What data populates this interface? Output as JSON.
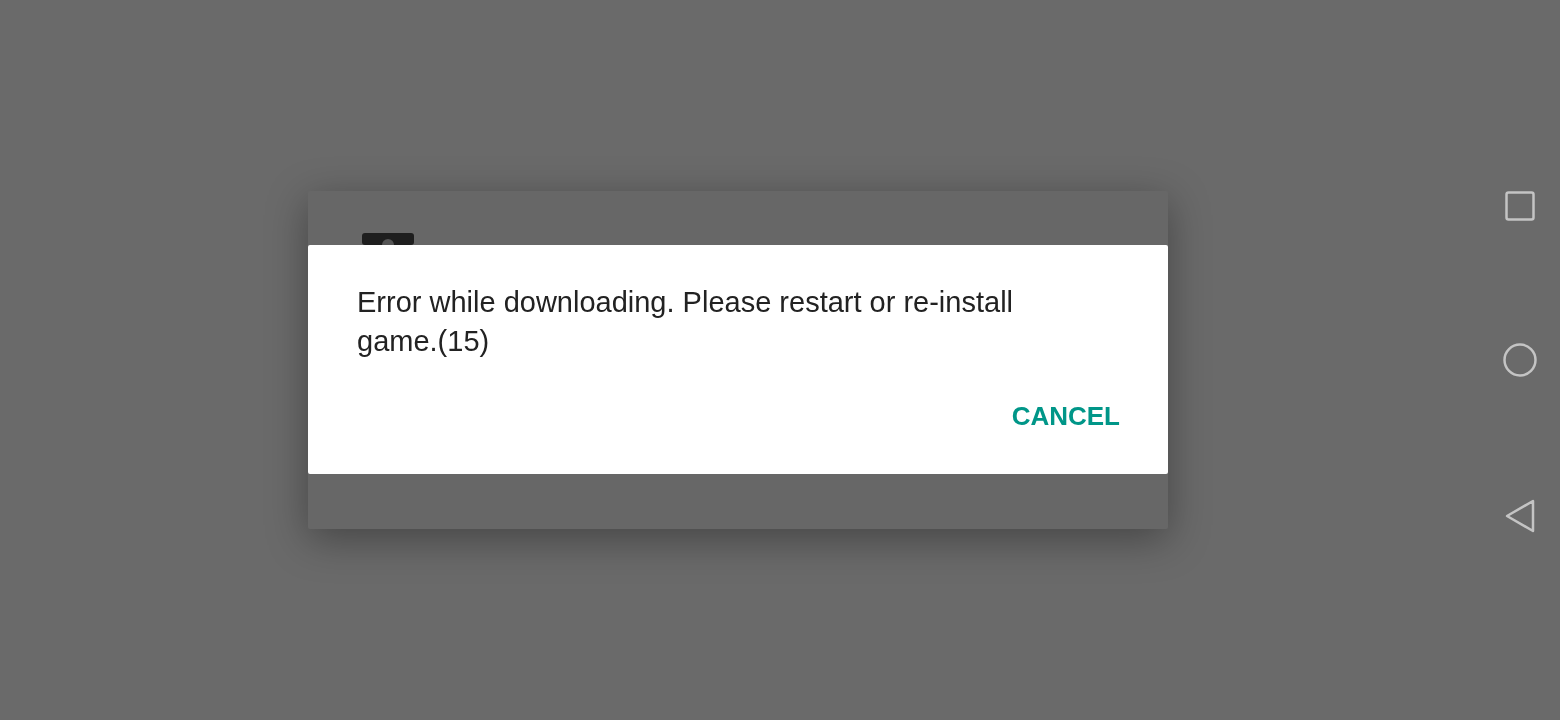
{
  "dialog": {
    "message": "Error while downloading. Please restart or re-install game.(15)",
    "buttons": [
      {
        "label": "CANCEL"
      }
    ]
  },
  "nav_bar": {
    "buttons": [
      {
        "kind": "recents"
      },
      {
        "kind": "home"
      },
      {
        "kind": "back"
      }
    ]
  }
}
